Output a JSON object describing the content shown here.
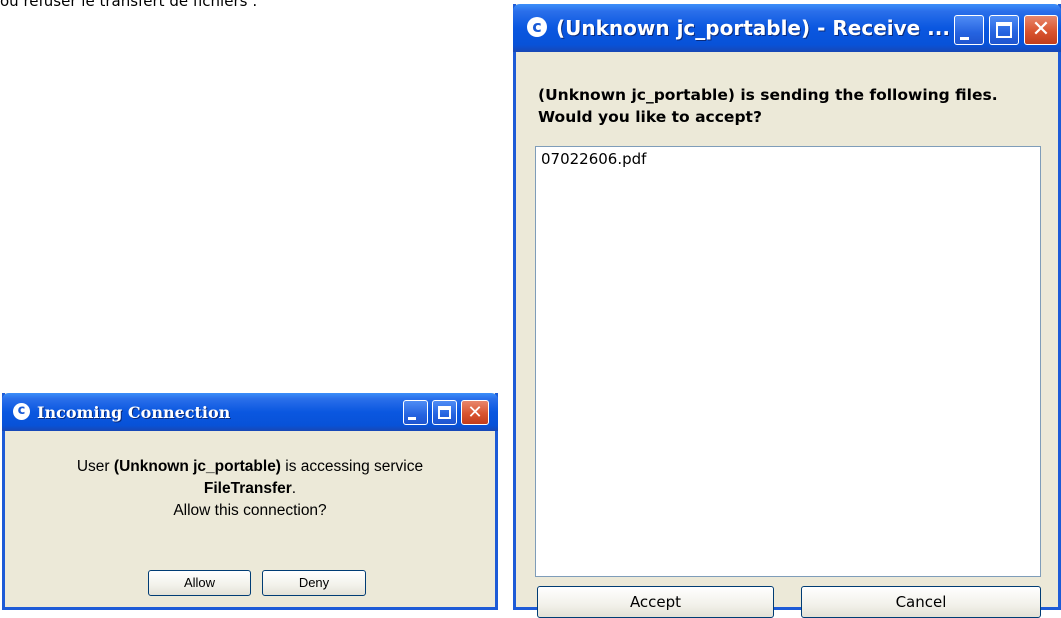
{
  "caption": "ou refuser le transfert de fichiers :",
  "incoming": {
    "title": "Incoming Connection",
    "icon_letter": "c",
    "line1_prefix": "User ",
    "line1_user": "(Unknown jc_portable)",
    "line1_suffix": " is accessing service",
    "service": "FileTransfer",
    "service_period": ".",
    "question": "Allow this connection?",
    "allow_label": "Allow",
    "deny_label": "Deny"
  },
  "receive": {
    "title": "(Unknown jc_portable) - Receive ...",
    "icon_letter": "c",
    "message_line1": "(Unknown jc_portable) is sending the following files.",
    "message_line2": "Would you like to accept?",
    "files": [
      "07022606.pdf"
    ],
    "accept_label": "Accept",
    "cancel_label": "Cancel"
  },
  "colors": {
    "titlebar": "#0A57E0",
    "window_bg": "#ECE9D8",
    "close_button": "#D9542F"
  }
}
